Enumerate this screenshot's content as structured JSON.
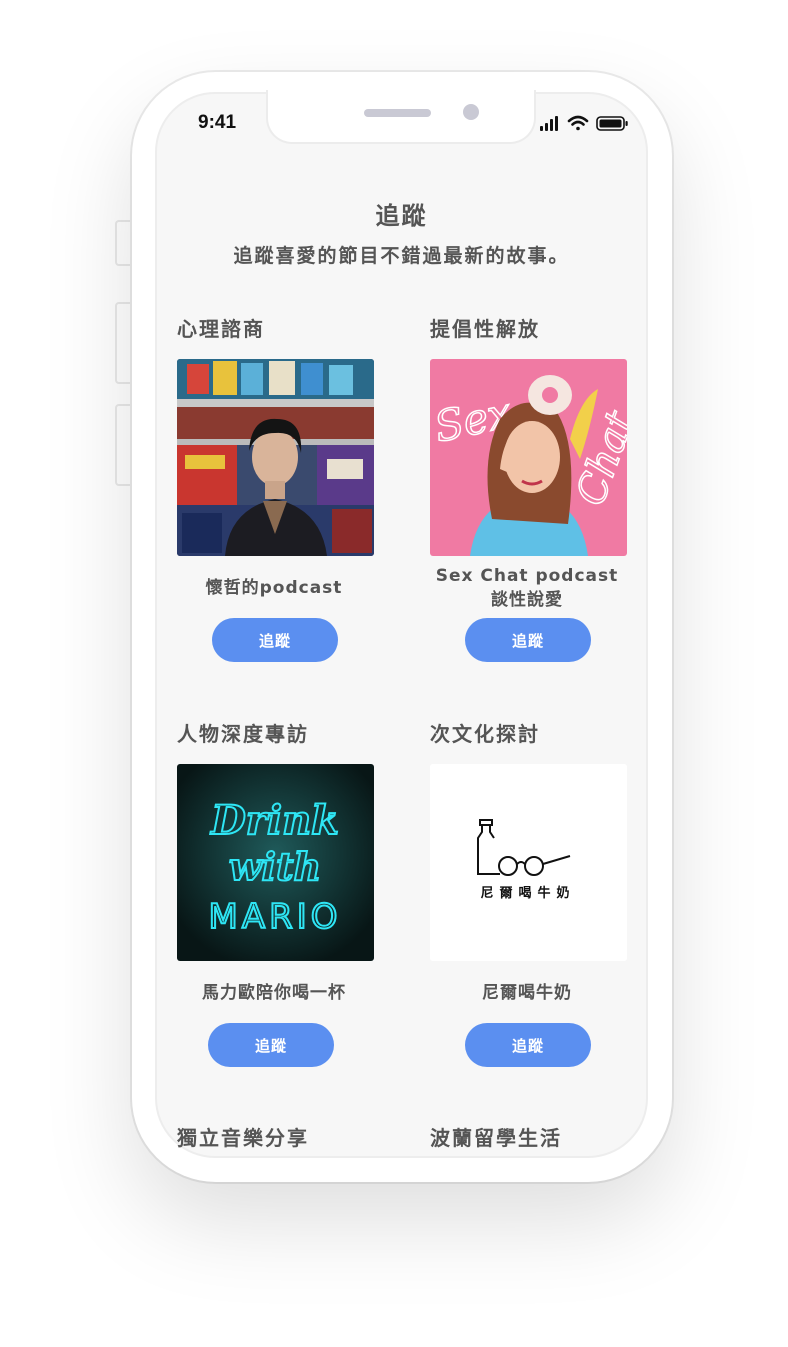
{
  "status_bar": {
    "time": "9:41"
  },
  "page": {
    "title": "追蹤",
    "subtitle": "追蹤喜愛的節目不錯過最新的故事。"
  },
  "cards": [
    {
      "category": "心理諮商",
      "name": "懷哲的podcast",
      "button": "追蹤"
    },
    {
      "category": "提倡性解放",
      "name_line1": "Sex Chat podcast",
      "name_line2": "談性說愛",
      "button": "追蹤"
    },
    {
      "category": "人物深度專訪",
      "name": "馬力歐陪你喝一杯",
      "button": "追蹤"
    },
    {
      "category": "次文化探討",
      "name": "尼爾喝牛奶",
      "button": "追蹤"
    },
    {
      "category": "獨立音樂分享"
    },
    {
      "category": "波蘭留學生活"
    }
  ],
  "covers": {
    "sex_chat": {
      "script_left": "Sex",
      "script_right": "Chat"
    },
    "drink": {
      "line1": "Drink",
      "line2": "with",
      "line3": "MARIO"
    },
    "milk": {
      "text": "尼爾喝牛奶"
    }
  },
  "colors": {
    "accent": "#5b8ff0",
    "pink": "#f07aa3",
    "neon": "#2ee6f5"
  },
  "icons": [
    "signal-icon",
    "wifi-icon",
    "battery-icon"
  ]
}
